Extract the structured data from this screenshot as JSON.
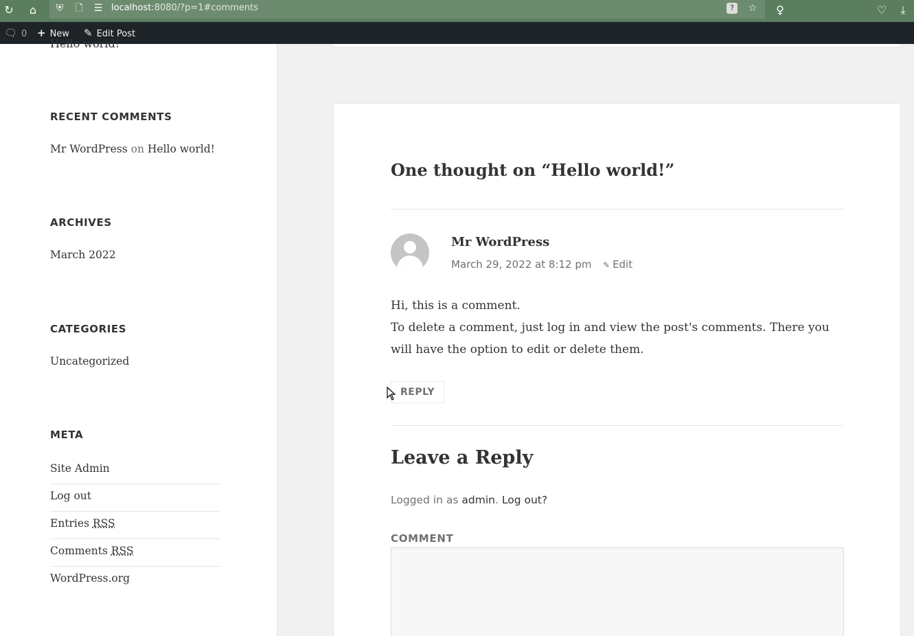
{
  "browser": {
    "url_host": "localhost",
    "url_rest": ":8080/?p=1#comments"
  },
  "adminbar": {
    "comments_count": "0",
    "new_label": "New",
    "edit_post_label": "Edit Post"
  },
  "sidebar": {
    "cut_post_title": "Hello world!",
    "recent_comments": {
      "title": "RECENT COMMENTS",
      "author": "Mr WordPress",
      "on": "on",
      "post": "Hello world!"
    },
    "archives": {
      "title": "ARCHIVES",
      "items": [
        "March 2022"
      ]
    },
    "categories": {
      "title": "CATEGORIES",
      "items": [
        "Uncategorized"
      ]
    },
    "meta": {
      "title": "META",
      "items": [
        "Site Admin",
        "Log out",
        "Entries",
        "Comments",
        "WordPress.org"
      ],
      "rss": "RSS"
    }
  },
  "comments": {
    "title": "One thought on “Hello world!”",
    "comment": {
      "author": "Mr WordPress",
      "date": "March 29, 2022 at 8:12 pm",
      "edit": "Edit",
      "body_line1": "Hi, this is a comment.",
      "body_line2": "To delete a comment, just log in and view the post's comments. There you will have the option to edit or delete them.",
      "reply": "REPLY"
    }
  },
  "respond": {
    "title": "Leave a Reply",
    "logged_in_prefix": "Logged in as",
    "user": "admin",
    "logout": "Log out?",
    "comment_label": "COMMENT"
  }
}
